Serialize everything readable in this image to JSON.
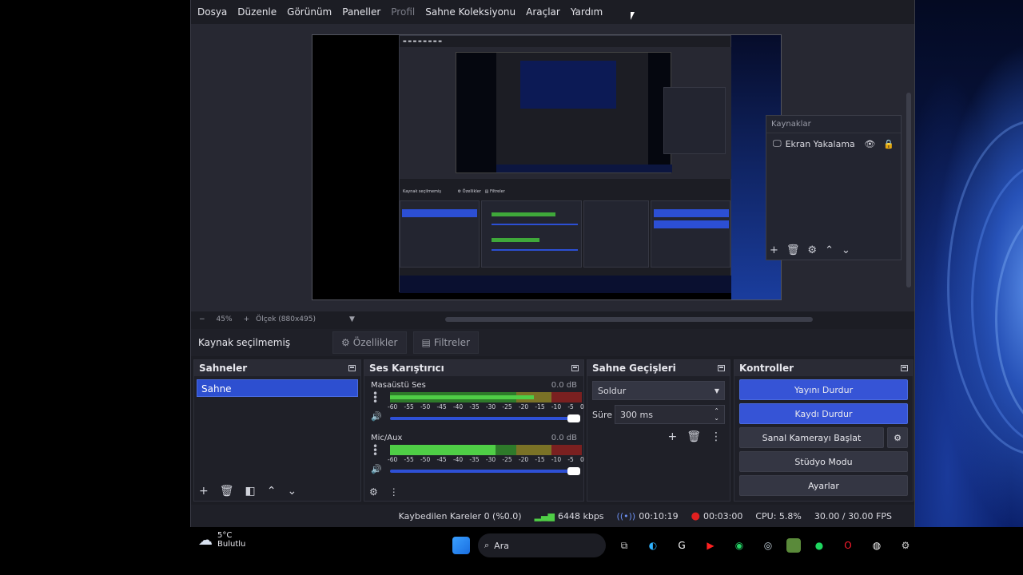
{
  "menu": {
    "items": [
      {
        "label": "Dosya",
        "enabled": true
      },
      {
        "label": "Düzenle",
        "enabled": true
      },
      {
        "label": "Görünüm",
        "enabled": true
      },
      {
        "label": "Paneller",
        "enabled": true
      },
      {
        "label": "Profil",
        "enabled": false
      },
      {
        "label": "Sahne Koleksiyonu",
        "enabled": true
      },
      {
        "label": "Araçlar",
        "enabled": true
      },
      {
        "label": "Yardım",
        "enabled": true
      }
    ]
  },
  "sources_panel": {
    "title": "Kaynaklar",
    "items": [
      {
        "label": "Ekran Yakalama",
        "icon": "monitor-icon"
      }
    ]
  },
  "zoom": {
    "minus": "−",
    "percent": "45%",
    "plus": "+",
    "scale_label": "Ölçek (880x495)"
  },
  "context": {
    "no_source": "Kaynak seçilmemiş",
    "properties": "Özellikler",
    "filters": "Filtreler"
  },
  "scenes": {
    "title": "Sahneler",
    "items": [
      {
        "label": "Sahne",
        "selected": true
      }
    ]
  },
  "mixer": {
    "title": "Ses Karıştırıcı",
    "channels": [
      {
        "name": "Masaüstü Ses",
        "db": "0.0 dB",
        "level": 0.75
      },
      {
        "name": "Mic/Aux",
        "db": "0.0 dB",
        "level": 0.55
      }
    ],
    "scale": [
      "-60",
      "-55",
      "-50",
      "-45",
      "-40",
      "-35",
      "-30",
      "-25",
      "-20",
      "-15",
      "-10",
      "-5",
      "0"
    ]
  },
  "transitions": {
    "title": "Sahne Geçişleri",
    "selected": "Soldur",
    "duration_label": "Süre",
    "duration_value": "300 ms"
  },
  "controls": {
    "title": "Kontroller",
    "stop_stream": "Yayını Durdur",
    "stop_record": "Kaydı Durdur",
    "virtual_cam": "Sanal Kamerayı Başlat",
    "studio_mode": "Stüdyo Modu",
    "settings": "Ayarlar"
  },
  "status": {
    "dropped": "Kaybedilen Kareler 0 (%0.0)",
    "bitrate": "6448 kbps",
    "stream_time": "00:10:19",
    "record_time": "00:03:00",
    "cpu": "CPU: 5.8%",
    "fps": "30.00 / 30.00 FPS"
  },
  "taskbar": {
    "temp": "5°C",
    "weather": "Bulutlu",
    "search": "Ara"
  },
  "colors": {
    "accent": "#3654d6",
    "meter_green": "#4fce46",
    "meter_yellow": "#b6a63a",
    "meter_red": "#c23a3a",
    "recording_red": "#e02020"
  }
}
